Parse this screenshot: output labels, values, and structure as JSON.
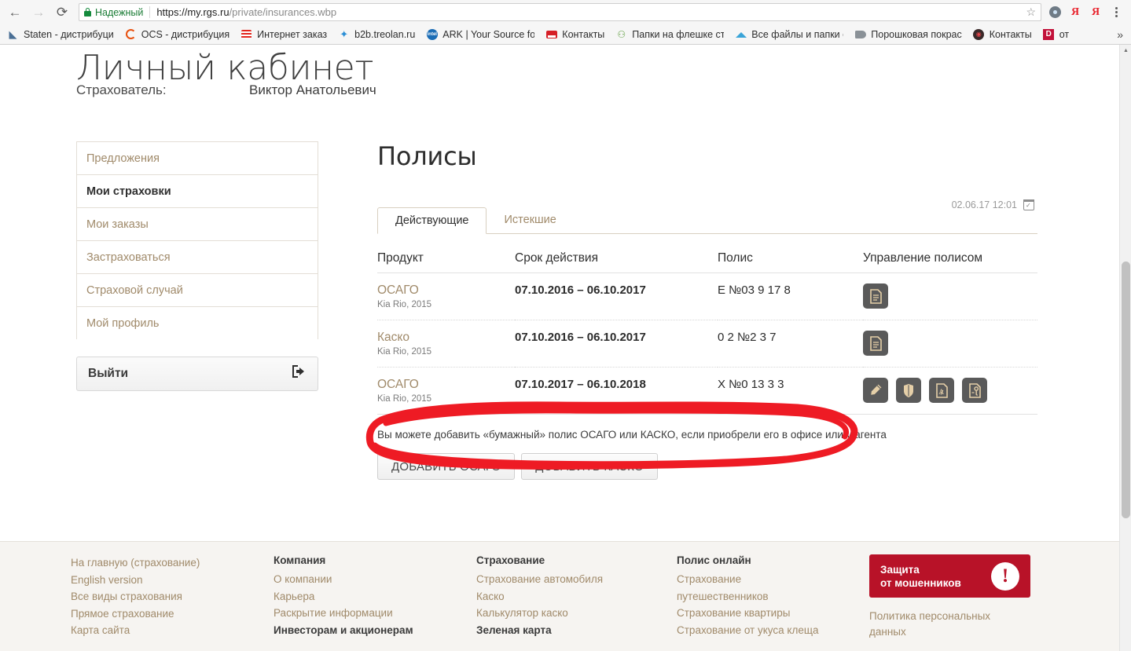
{
  "browser": {
    "back_icon": "←",
    "forward_icon": "→",
    "reload_icon": "⟳",
    "secure_label": "Надежный",
    "url_host": "https://my.rgs.ru",
    "url_path": "/private/insurances.wbp",
    "star_icon": "☆",
    "overflow_icon": "»",
    "bookmarks": [
      {
        "label": "Staten - дистрибуци",
        "icon": "staten-icon"
      },
      {
        "label": "OCS - дистрибуция",
        "icon": "ocs-icon"
      },
      {
        "label": "Интернет заказ",
        "icon": "stripes-icon"
      },
      {
        "label": "b2b.treolan.ru",
        "icon": "b2b-icon"
      },
      {
        "label": "ARK | Your Source fo",
        "icon": "intel-icon"
      },
      {
        "label": "Контакты",
        "icon": "contacts-icon"
      },
      {
        "label": "Папки на флешке ст",
        "icon": "person-icon"
      },
      {
        "label": "Все файлы и папки с",
        "icon": "diamond-icon"
      },
      {
        "label": "Порошковая покрас",
        "icon": "spray-icon"
      },
      {
        "label": "Контакты",
        "icon": "dark-circle-icon"
      },
      {
        "label": "от",
        "icon": "opera-icon"
      }
    ]
  },
  "header": {
    "title": "Личный кабинет",
    "insurer_label": "Страхователь:",
    "insurer_name": "Виктор Анатольевич"
  },
  "sidebar": {
    "items": [
      {
        "label": "Предложения",
        "active": false
      },
      {
        "label": "Мои страховки",
        "active": true
      },
      {
        "label": "Мои заказы",
        "active": false
      },
      {
        "label": "Застраховаться",
        "active": false
      },
      {
        "label": "Страховой случай",
        "active": false
      },
      {
        "label": "Мой профиль",
        "active": false
      }
    ],
    "logout_label": "Выйти",
    "logout_icon": "→]"
  },
  "main": {
    "title": "Полисы",
    "timestamp": "02.06.17 12:01",
    "tabs": [
      {
        "label": "Действующие",
        "active": true
      },
      {
        "label": "Истекшие",
        "active": false
      }
    ],
    "table": {
      "columns": [
        "Продукт",
        "Срок действия",
        "Полис",
        "Управление полисом"
      ],
      "rows": [
        {
          "product": "ОСАГО",
          "vehicle": "Kia Rio, 2015",
          "term": "07.10.2016 – 06.10.2017",
          "policy": "Е    №03  9  17  8",
          "actions": [
            "document-icon"
          ]
        },
        {
          "product": "Каско",
          "vehicle": "Kia Rio, 2015",
          "term": "07.10.2016 – 06.10.2017",
          "policy": "0  2 №2  3  7",
          "actions": [
            "document-icon"
          ]
        },
        {
          "product": "ОСАГО",
          "vehicle": "Kia Rio, 2015",
          "term": "07.10.2017 – 06.10.2018",
          "policy": "X    №0  13  3  3",
          "actions": [
            "pencil-icon",
            "shield-icon",
            "pdf-icon",
            "document-key-icon"
          ],
          "highlighted": true
        }
      ]
    },
    "paper_note": "Вы можете добавить «бумажный» полис ОСАГО или КАСКО, если приобрели его в офисе или у агента",
    "add_osago_label": "ДОБАВИТЬ ОСАГО",
    "add_kasko_label": "ДОБАВИТЬ КАСКО"
  },
  "footer": {
    "col1": [
      {
        "label": "На главную (страхование)"
      },
      {
        "label": "English version"
      },
      {
        "label": "Все виды страхования"
      },
      {
        "label": "Прямое страхование"
      },
      {
        "label": "Карта сайта"
      }
    ],
    "col2_head": "Компания",
    "col2": [
      {
        "label": "О компании"
      },
      {
        "label": "Карьера"
      },
      {
        "label": "Раскрытие информации"
      },
      {
        "label": "Инвесторам и акционерам",
        "bold": true
      }
    ],
    "col3_head": "Страхование",
    "col3": [
      {
        "label": "Страхование автомобиля"
      },
      {
        "label": "Каско"
      },
      {
        "label": "Калькулятор каско"
      },
      {
        "label": "Зеленая карта",
        "bold": true
      }
    ],
    "col4_head": "Полис онлайн",
    "col4": [
      {
        "label": "Страхование путешественников"
      },
      {
        "label": "Страхование квартиры"
      },
      {
        "label": "Страхование от укуса клеща"
      }
    ],
    "banner_line1": "Защита",
    "banner_line2": "от мошенников",
    "banner_icon": "!",
    "privacy_label": "Политика персональных данных"
  },
  "colors": {
    "accent_gold": "#a08a6a",
    "brand_red": "#b81228",
    "annotation_red": "#ee1b24",
    "icon_bg": "#5a5a5a",
    "secure_green": "#148a3c"
  }
}
